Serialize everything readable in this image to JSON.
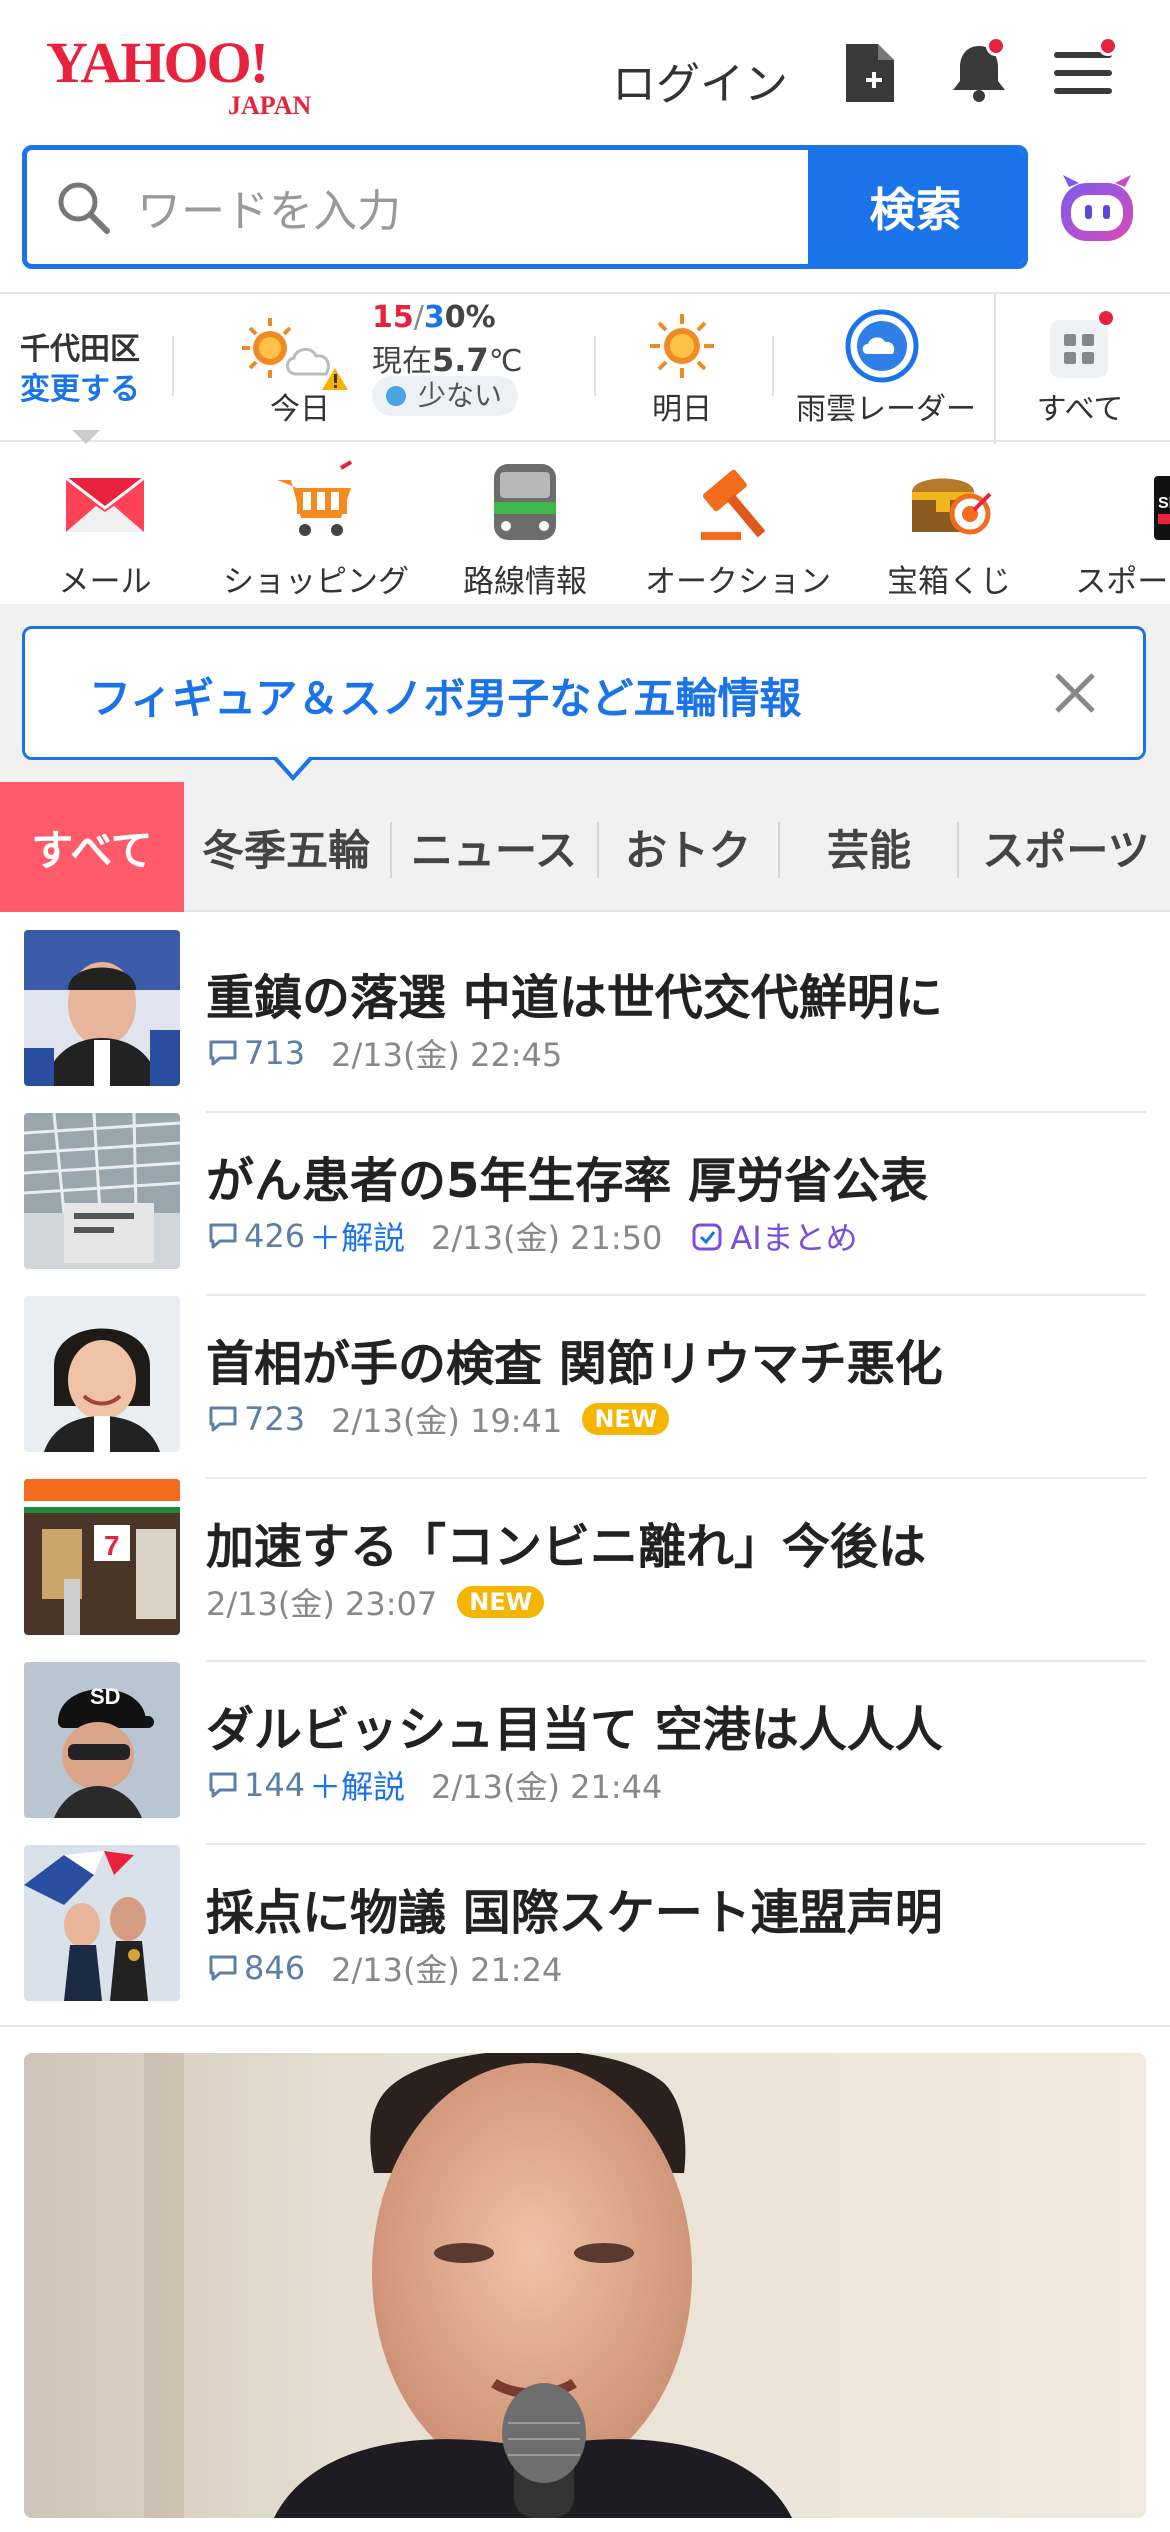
{
  "header": {
    "logo_text": "YAHOO!",
    "logo_sub": "JAPAN",
    "login": "ログイン",
    "icons": [
      "add-document-icon",
      "bell-icon",
      "menu-icon"
    ]
  },
  "search": {
    "placeholder": "ワードを入力",
    "button": "検索"
  },
  "weather": {
    "location": "千代田区",
    "change": "変更する",
    "today_label": "今日",
    "high": "15",
    "low": "3",
    "precip": "0%",
    "now_label": "現在",
    "now_temp": "5.7",
    "now_unit": "℃",
    "pollen": "少ない",
    "tomorrow_label": "明日",
    "radar_label": "雨雲レーダー",
    "all_label": "すべて"
  },
  "services": [
    {
      "label": "メール",
      "icon": "mail-icon"
    },
    {
      "label": "ショッピング",
      "icon": "cart-icon"
    },
    {
      "label": "路線情報",
      "icon": "train-icon"
    },
    {
      "label": "オークション",
      "icon": "gavel-icon"
    },
    {
      "label": "宝箱くじ",
      "icon": "treasure-icon"
    },
    {
      "label": "スポーツ",
      "icon": "sports-icon"
    }
  ],
  "notice": {
    "text": "フィギュア＆スノボ男子など五輪情報"
  },
  "tabs": [
    "すべて",
    "冬季五輪",
    "ニュース",
    "おトク",
    "芸能",
    "スポーツ"
  ],
  "news": [
    {
      "title": "重鎮の落選 中道は世代交代鮮明に",
      "comments": "713",
      "kaisetsu": "",
      "date": "2/13(金) 22:45",
      "badge": "",
      "ai": ""
    },
    {
      "title": "がん患者の5年生存率 厚労省公表",
      "comments": "426",
      "kaisetsu": "＋解説",
      "date": "2/13(金) 21:50",
      "badge": "",
      "ai": "AIまとめ"
    },
    {
      "title": "首相が手の検査 関節リウマチ悪化",
      "comments": "723",
      "kaisetsu": "",
      "date": "2/13(金) 19:41",
      "badge": "NEW",
      "ai": ""
    },
    {
      "title": "加速する「コンビニ離れ」今後は",
      "comments": "",
      "kaisetsu": "",
      "date": "2/13(金) 23:07",
      "badge": "NEW",
      "ai": ""
    },
    {
      "title": "ダルビッシュ目当て 空港は人人人",
      "comments": "144",
      "kaisetsu": "＋解説",
      "date": "2/13(金) 21:44",
      "badge": "",
      "ai": ""
    },
    {
      "title": "採点に物議 国際スケート連盟声明",
      "comments": "846",
      "kaisetsu": "",
      "date": "2/13(金) 21:24",
      "badge": "",
      "ai": ""
    }
  ],
  "colors": {
    "brand_red": "#e8223d",
    "accent_blue": "#1a73e8",
    "tab_active": "#ff5a6a",
    "new_badge": "#f5b400"
  }
}
